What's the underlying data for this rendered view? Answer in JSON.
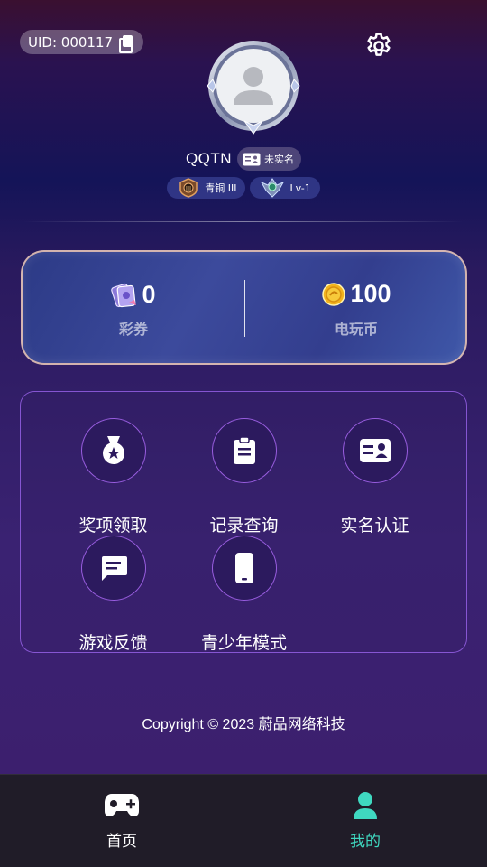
{
  "header": {
    "uid_label": "UID: 000117",
    "nickname": "QQTN",
    "realname_status": "未实名",
    "rank_label": "青铜 III",
    "level_label": "Lv-1"
  },
  "wallet": {
    "lottery": {
      "value": "0",
      "label": "彩券"
    },
    "coins": {
      "value": "100",
      "label": "电玩币"
    }
  },
  "menu": {
    "items": [
      {
        "label": "奖项领取",
        "icon": "medal-icon"
      },
      {
        "label": "记录查询",
        "icon": "clipboard-icon"
      },
      {
        "label": "实名认证",
        "icon": "id-card-icon"
      },
      {
        "label": "游戏反馈",
        "icon": "feedback-icon"
      },
      {
        "label": "青少年模式",
        "icon": "phone-icon"
      }
    ]
  },
  "footer": {
    "copyright": "Copyright © 2023 蔚品网络科技"
  },
  "tabbar": {
    "tabs": [
      {
        "label": "首页",
        "icon": "gamepad-icon",
        "active": false
      },
      {
        "label": "我的",
        "icon": "user-icon",
        "active": true
      }
    ]
  },
  "colors": {
    "accent": "#3fd8c0",
    "wallet_border": "#f0c8b4",
    "menu_border": "#aa6eff",
    "tabbar_bg": "#201c28"
  }
}
